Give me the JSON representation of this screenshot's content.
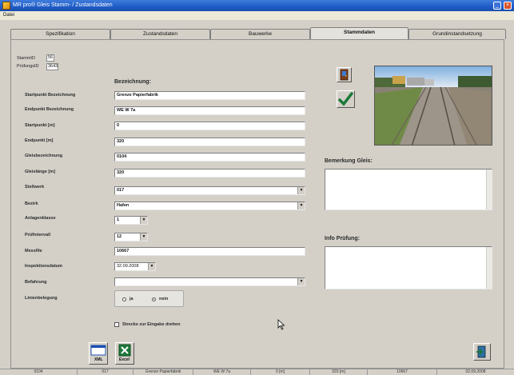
{
  "window": {
    "title": "MR pro® Gleis Stamm- / Zustandsdaten"
  },
  "menu": {
    "item": "Datei"
  },
  "tabs": [
    {
      "label": "Spezifikation"
    },
    {
      "label": "Zustandsdaten"
    },
    {
      "label": "Bauwerke"
    },
    {
      "label": "Stammdaten"
    },
    {
      "label": "Grundinstandsetzung"
    }
  ],
  "ids": {
    "stamm_label": "StammID",
    "stamm_value": "56",
    "pruef_label": "PrüfungsID",
    "pruef_value": "3643"
  },
  "bezeichnung_header": "Bezeichnung:",
  "fields": [
    {
      "label": "Startpunkt Bezeichnung",
      "value": "Grenze Papierfabrik"
    },
    {
      "label": "Endpunkt Bezeichnung",
      "value": "WE W 7a"
    },
    {
      "label": "Startpunkt [m]",
      "value": "0"
    },
    {
      "label": "Endpunkt [m]",
      "value": "320"
    },
    {
      "label": "Gleisbezeichnung",
      "value": "0104"
    },
    {
      "label": "Gleislänge [m]",
      "value": "320"
    },
    {
      "label": "Stellwerk",
      "value": "017"
    },
    {
      "label": "Bezirk",
      "value": "Hafen"
    },
    {
      "label": "Anlagenklasse",
      "value": "1"
    },
    {
      "label": "Prüfintervall",
      "value": "12"
    },
    {
      "label": "Messfile",
      "value": "10667"
    },
    {
      "label": "Inspektionsdatum",
      "value": "32.09.2008"
    },
    {
      "label": "Befahrung",
      "value": ""
    },
    {
      "label": "Linienbelegung",
      "value": ""
    }
  ],
  "radio": {
    "ja": "ja",
    "nein": "nein",
    "selected": "nein"
  },
  "checkbox": {
    "label": "Strecke zur Eingabe drehen"
  },
  "bemerkung_label": "Bemerkung Gleis:",
  "info_label": "Info Prüfung:",
  "buttons": {
    "xml": "XML",
    "excel": "Excel"
  },
  "statusbar": [
    "0104",
    "017",
    "Grenze Papierfabrik",
    "WE W 7a",
    "0 [m]",
    "320 [m]",
    "10667",
    "02.09.2008"
  ],
  "icons": {
    "door": "door-icon",
    "check": "checkmark-icon",
    "xml": "xml-export-icon",
    "excel": "excel-icon",
    "exit": "exit-icon"
  }
}
